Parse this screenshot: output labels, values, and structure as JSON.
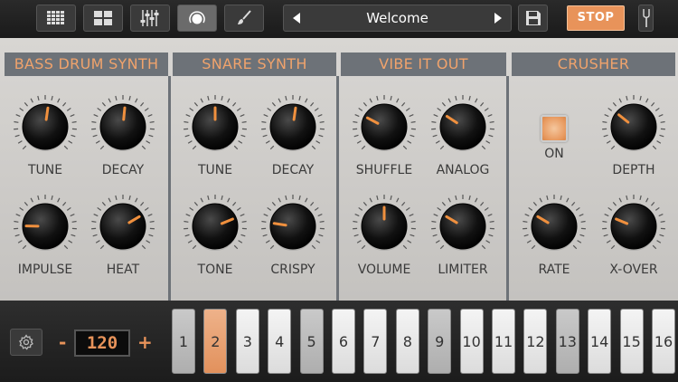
{
  "toolbar": {
    "buttons": [
      {
        "name": "pattern-grid-button",
        "icon": "grid-icon",
        "active": false
      },
      {
        "name": "kit-layout-button",
        "icon": "layout-icon",
        "active": false
      },
      {
        "name": "mixer-button",
        "icon": "mixer-icon",
        "active": false
      },
      {
        "name": "synth-view-button",
        "icon": "knob-icon",
        "active": true
      },
      {
        "name": "effects-button",
        "icon": "brush-icon",
        "active": false
      }
    ],
    "preset_name": "Welcome",
    "stop_label": "STOP"
  },
  "colors": {
    "accent": "#e8935a",
    "header_bg": "#6d7278",
    "header_text": "#f0a36c"
  },
  "sections": [
    {
      "title": "BASS DRUM SYNTH",
      "knobs": [
        {
          "label": "TUNE",
          "value": 0.53
        },
        {
          "label": "DECAY",
          "value": 0.52
        },
        {
          "label": "IMPULSE",
          "value": 0.17
        },
        {
          "label": "HEAT",
          "value": 0.72
        }
      ]
    },
    {
      "title": "SNARE SYNTH",
      "knobs": [
        {
          "label": "TUNE",
          "value": 0.5
        },
        {
          "label": "DECAY",
          "value": 0.53
        },
        {
          "label": "TONE",
          "value": 0.75
        },
        {
          "label": "CRISPY",
          "value": 0.2
        }
      ]
    },
    {
      "title": "VIBE IT OUT",
      "knobs": [
        {
          "label": "SHUFFLE",
          "value": 0.27
        },
        {
          "label": "ANALOG",
          "value": 0.29
        },
        {
          "label": "VOLUME",
          "value": 0.5
        },
        {
          "label": "LIMITER",
          "value": 0.28
        }
      ]
    },
    {
      "title": "CRUSHER",
      "on_label": "ON",
      "knobs": [
        {
          "label": "DEPTH",
          "value": 0.31
        },
        {
          "label": "RATE",
          "value": 0.28
        },
        {
          "label": "X-OVER",
          "value": 0.25
        }
      ]
    }
  ],
  "transport": {
    "minus": "-",
    "plus": "+",
    "tempo": "120"
  },
  "steps": [
    {
      "label": "1",
      "state": "grey"
    },
    {
      "label": "2",
      "state": "on"
    },
    {
      "label": "3",
      "state": "white"
    },
    {
      "label": "4",
      "state": "white"
    },
    {
      "label": "5",
      "state": "grey"
    },
    {
      "label": "6",
      "state": "white"
    },
    {
      "label": "7",
      "state": "white"
    },
    {
      "label": "8",
      "state": "white"
    },
    {
      "label": "9",
      "state": "grey"
    },
    {
      "label": "10",
      "state": "white"
    },
    {
      "label": "11",
      "state": "white"
    },
    {
      "label": "12",
      "state": "white"
    },
    {
      "label": "13",
      "state": "grey"
    },
    {
      "label": "14",
      "state": "white"
    },
    {
      "label": "15",
      "state": "white"
    },
    {
      "label": "16",
      "state": "white"
    }
  ]
}
